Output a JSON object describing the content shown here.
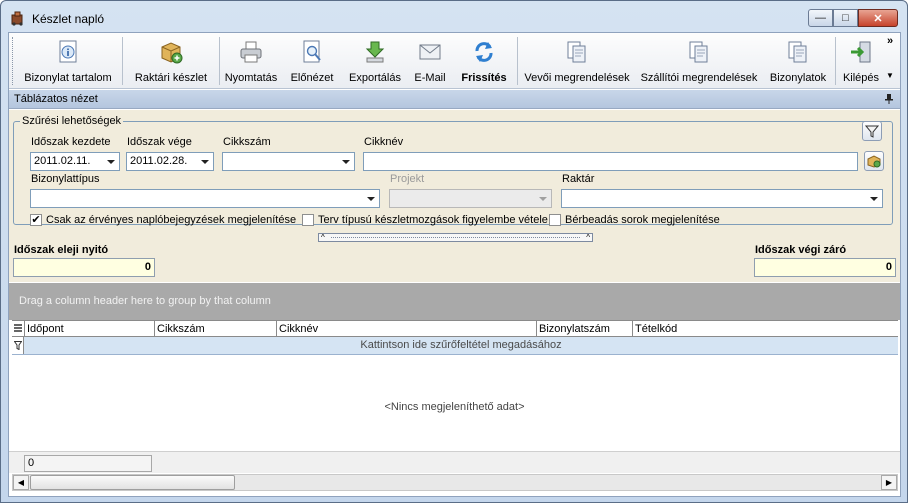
{
  "window": {
    "title": "Készlet napló",
    "minimize_glyph": "—",
    "maximize_glyph": "□",
    "close_glyph": "✕"
  },
  "toolbar": {
    "buttons": [
      {
        "label": "Bizonylat tartalom",
        "icon": "document-info-icon"
      },
      {
        "label": "Raktári készlet",
        "icon": "stock-box-icon"
      },
      {
        "label": "Nyomtatás",
        "icon": "printer-icon"
      },
      {
        "label": "Előnézet",
        "icon": "preview-icon"
      },
      {
        "label": "Exportálás",
        "icon": "export-icon"
      },
      {
        "label": "E-Mail",
        "icon": "email-icon"
      },
      {
        "label": "Frissítés",
        "icon": "refresh-icon"
      },
      {
        "label": "Vevői megrendelések",
        "icon": "documents-icon"
      },
      {
        "label": "Szállítói megrendelések",
        "icon": "documents-icon"
      },
      {
        "label": "Bizonylatok",
        "icon": "documents-icon"
      },
      {
        "label": "Kilépés",
        "icon": "exit-icon"
      }
    ],
    "overflow": "»"
  },
  "section": {
    "title": "Táblázatos nézet"
  },
  "filters": {
    "legend": "Szűrési lehetőségek",
    "period_start_label": "Időszak kezdete",
    "period_start_value": "2011.02.11.",
    "period_end_label": "Időszak vége",
    "period_end_value": "2011.02.28.",
    "item_code_label": "Cikkszám",
    "item_code_value": "",
    "item_name_label": "Cikknév",
    "item_name_value": "",
    "doc_type_label": "Bizonylattípus",
    "doc_type_value": "",
    "project_label": "Projekt",
    "project_value": "",
    "warehouse_label": "Raktár",
    "warehouse_value": "",
    "checkboxes": [
      {
        "label": "Csak az érvényes naplóbejegyzések megjelenítése",
        "checked": true
      },
      {
        "label": "Terv típusú készletmozgások figyelembe vétele",
        "checked": false
      },
      {
        "label": "Bérbeadás sorok megjelenítése",
        "checked": false
      }
    ]
  },
  "totals": {
    "opening_label": "Időszak eleji nyitó",
    "opening_value": "0",
    "closing_label": "Időszak végi záró",
    "closing_value": "0"
  },
  "grid": {
    "group_hint": "Drag a column header here to group by that column",
    "columns": [
      "Időpont",
      "Cikkszám",
      "Cikknév",
      "Bizonylatszám",
      "Tételkód"
    ],
    "filter_hint": "Kattintson ide szűrőfeltétel megadásához",
    "empty_text": "<Nincs megjeleníthető adat>",
    "count": "0"
  }
}
